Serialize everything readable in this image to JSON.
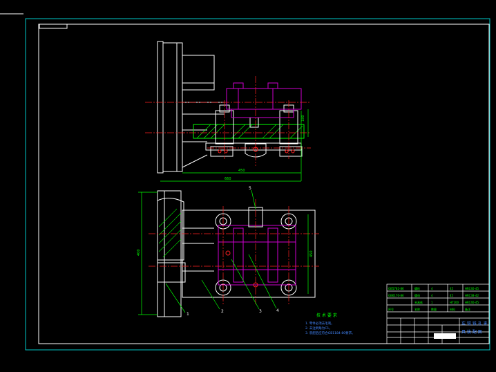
{
  "colors": {
    "background": "#000000",
    "border": "#00c8c8",
    "outline": "#ffffff",
    "centerline": "#ff2020",
    "part": "#d000d0",
    "dimension": "#00ff00",
    "hatch": "#00ff00",
    "notes": "#4488ff"
  },
  "dimensions": {
    "top_width": "660",
    "top_width2": "450",
    "top_height": "180",
    "bottom_height": "400",
    "bottom_height2": "450"
  },
  "callouts": [
    "1",
    "2",
    "3",
    "4",
    "5"
  ],
  "notes": {
    "title": "技 术 要 求",
    "lines": [
      "1. 零件必须去毛刺。",
      "2. 未注倒角为C1。",
      "3. 装配后应符合GB1184-80要求。"
    ]
  },
  "title_block": {
    "name_line1": "车 钳 铣 孔 夹",
    "name_line2": "具 装 配 图",
    "rows": [
      [
        "GB5782-86",
        "螺栓",
        "4",
        "45",
        "HRC40-45"
      ],
      [
        "GB6170-86",
        "螺母",
        "4",
        "45",
        "HRC38-42"
      ],
      [
        "",
        "夹具体",
        "1",
        "HT200",
        "HRC40-45"
      ]
    ],
    "header": [
      "序号",
      "名称",
      "数量",
      "材料",
      "备注"
    ]
  }
}
